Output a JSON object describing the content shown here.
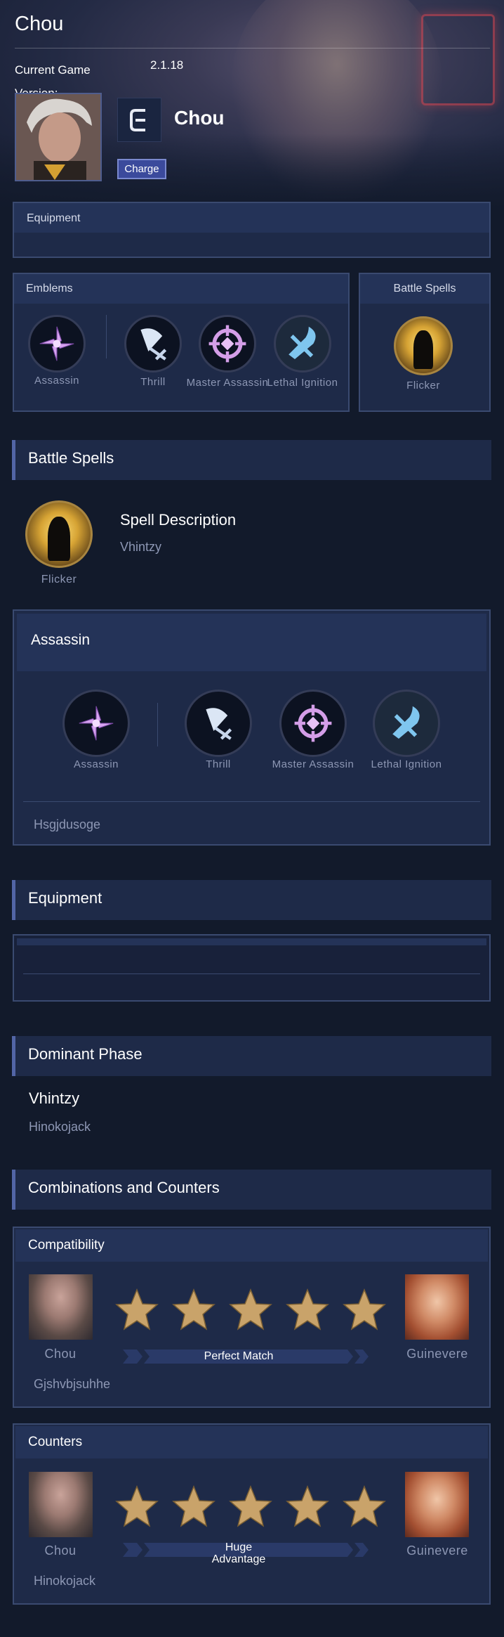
{
  "header": {
    "title": "Chou",
    "game_version_label": "Current Game Version:",
    "game_version_value": "2.1.18",
    "hero_name": "Chou",
    "charge_label": "Charge"
  },
  "summary": {
    "equipment_label": "Equipment",
    "emblems_label": "Emblems",
    "battle_spells_label": "Battle Spells",
    "emblems": [
      {
        "label": "Assassin"
      },
      {
        "label": "Thrill"
      },
      {
        "label": "Master Assassin"
      },
      {
        "label": "Lethal Ignition"
      }
    ],
    "spell": {
      "label": "Flicker"
    }
  },
  "sections": {
    "battle_spells": "Battle Spells",
    "equipment": "Equipment",
    "dominant_phase": "Dominant Phase",
    "combos": "Combinations and Counters"
  },
  "spell_detail": {
    "name": "Flicker",
    "title": "Spell Description",
    "description": "Vhintzy"
  },
  "emblem_detail": {
    "title": "Assassin",
    "items": [
      {
        "label": "Assassin"
      },
      {
        "label": "Thrill"
      },
      {
        "label": "Master Assassin"
      },
      {
        "label": "Lethal Ignition"
      }
    ],
    "note": "Hsgjdusoge"
  },
  "dominant_phase": {
    "title": "Vhintzy",
    "text": "Hinokojack"
  },
  "compatibility": {
    "title": "Compatibility",
    "left_hero": "Chou",
    "right_hero": "Guinevere",
    "rating": 5,
    "rating_label": "Perfect Match",
    "note": "Gjshvbjsuhhe"
  },
  "counters": {
    "title": "Counters",
    "left_hero": "Chou",
    "right_hero": "Guinevere",
    "rating": 5,
    "rating_label": "Huge Advantage",
    "note": "Hinokojack"
  },
  "colors": {
    "background": "#121a2b",
    "panel": "#1e2a48",
    "accent": "#5265a6",
    "star": "#c9a36a",
    "muted_text": "#8d97b4"
  }
}
